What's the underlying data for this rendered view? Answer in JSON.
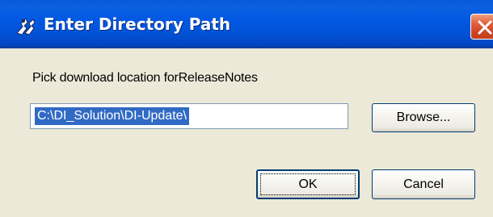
{
  "window": {
    "title": "Enter Directory Path",
    "app_icon": "app-icon",
    "close_icon": "close-icon"
  },
  "content": {
    "prompt_label": "Pick download location forReleaseNotes",
    "path_value": "C:\\DI_Solution\\DI-Update\\"
  },
  "buttons": {
    "browse_label": "Browse...",
    "ok_label": "OK",
    "cancel_label": "Cancel"
  },
  "colors": {
    "titlebar": "#0358e3",
    "close_button": "#e2623f",
    "selection": "#316ac5",
    "dialog_background": "#ece9d8"
  }
}
